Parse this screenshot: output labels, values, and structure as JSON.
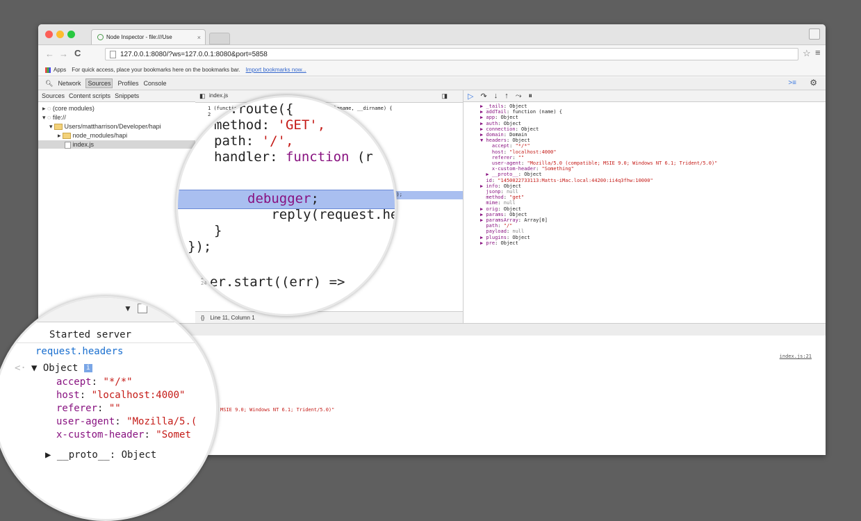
{
  "browser": {
    "tab_title": "Node Inspector - file:///Use",
    "tab_close": "×",
    "url": "127.0.0.1:8080/?ws=127.0.0.1:8080&port=5858",
    "bookmarks": {
      "apps": "Apps",
      "hint": "For quick access, place your bookmarks here on the bookmarks bar.",
      "import_link": "Import bookmarks now..."
    }
  },
  "devtools": {
    "tabs": [
      "Network",
      "Sources",
      "Profiles",
      "Console"
    ],
    "selected_tab": "Sources",
    "navigator": {
      "tabs": [
        "Sources",
        "Content scripts",
        "Snippets"
      ],
      "tree": [
        "(core modules)",
        "file://",
        "Users/mattharrison/Developer/hapi",
        "node_modules/hapi",
        "index.js"
      ]
    },
    "editor": {
      "file_tab": "index.js",
      "lines_top": [
        "1 (function (exports, require, module, __filename, __dirname) {",
        "2"
      ],
      "highlight_tail": "eader\"]);",
      "lines_bottom_nums": [
        "21",
        "22",
        "23",
        "24"
      ],
      "line_24": "});",
      "status": "Line 11, Column 1"
    },
    "scope": {
      "lines": [
        "▶ _tails: Object",
        "▶ addTail: function (name) {",
        "▶ app: Object",
        "▶ auth: Object",
        "▶ connection: Object",
        "▶ domain: Domain",
        "▼ headers: Object",
        "    accept: \"*/*\"",
        "    host: \"localhost:4000\"",
        "    referer: \"\"",
        "    user-agent: \"Mozilla/5.0 (compatible; MSIE 9.0; Windows NT 6.1; Trident/5.0)\"",
        "    x-custom-header: \"Something\"",
        "  ▶ __proto__: Object",
        "  id: \"1450022733113:Matts-iMac.local:44200:ii4q3fhw:10000\"",
        "▶ info: Object",
        "  jsonp: null",
        "  method: \"get\"",
        "  mime: null",
        "▶ orig: Object",
        "▶ params: Object",
        "▶ paramsArray: Array[0]",
        "  path: \"/\"",
        "  payload: null",
        "▶ plugins: Object",
        "▶ pre: Object"
      ]
    },
    "console": {
      "source_link": "index.js:21",
      "useragent_tail": "MSIE 9.0; Windows NT 6.1; Trident/5.0)\""
    }
  },
  "magnifier_editor": {
    "lines": [
      "er.route({",
      "method: 'GET',",
      "path: '/',",
      "handler: function (r",
      "",
      "   debugger;",
      "   reply(request.he",
      "}",
      "});",
      "",
      "er.start((err) =>"
    ]
  },
  "magnifier_console": {
    "log": "Started server",
    "command": "request.headers",
    "object": "Object",
    "entries": [
      {
        "key": "accept",
        "value": "\"*/*\""
      },
      {
        "key": "host",
        "value": "\"localhost:4000\""
      },
      {
        "key": "referer",
        "value": "\"\""
      },
      {
        "key": "user-agent",
        "value": "\"Mozilla/5.("
      },
      {
        "key": "x-custom-header",
        "value": "\"Somet"
      }
    ],
    "proto": "▶ __proto__: Object"
  },
  "colors": {
    "highlight": "#a9bff0",
    "key": "#881280",
    "string": "#c41a16",
    "console_command": "#1a6fcf"
  }
}
